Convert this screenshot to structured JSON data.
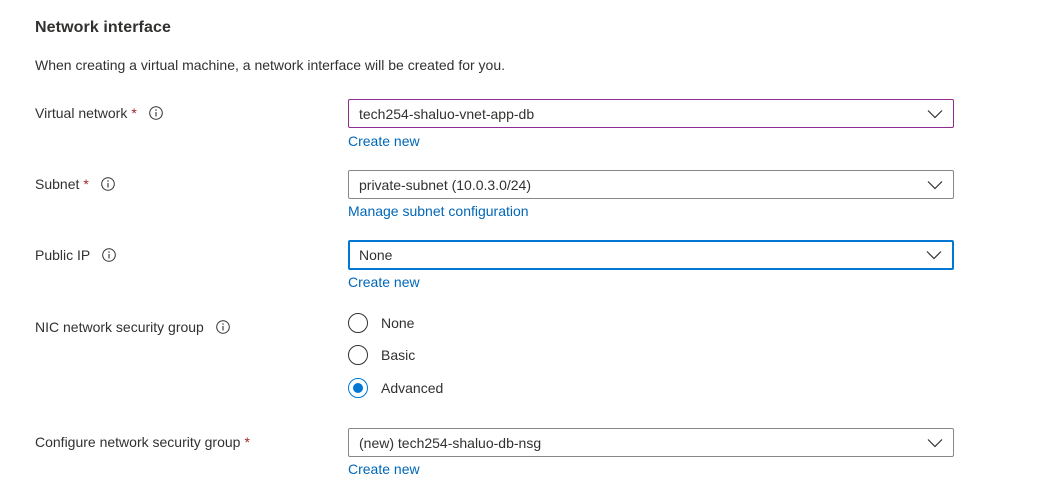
{
  "section": {
    "title": "Network interface",
    "description": "When creating a virtual machine, a network interface will be created for you."
  },
  "fields": {
    "virtual_network": {
      "label": "Virtual network",
      "required_mark": "*",
      "value": "tech254-shaluo-vnet-app-db",
      "link": "Create new"
    },
    "subnet": {
      "label": "Subnet",
      "required_mark": "*",
      "value": "private-subnet (10.0.3.0/24)",
      "link": "Manage subnet configuration"
    },
    "public_ip": {
      "label": "Public IP",
      "value": "None",
      "link": "Create new"
    },
    "nic_nsg": {
      "label": "NIC network security group",
      "options": [
        "None",
        "Basic",
        "Advanced"
      ],
      "selected": "Advanced"
    },
    "configure_nsg": {
      "label": "Configure network security group",
      "required_mark": "*",
      "value": "(new) tech254-shaluo-db-nsg",
      "link": "Create new"
    }
  },
  "colors": {
    "link": "#0067b8",
    "required": "#a4262c",
    "focus_border": "#0078d4",
    "accent_border": "#8d2b8f",
    "text": "#323130"
  },
  "icons": {
    "info": "info-icon",
    "dropdown": "chevron-down-icon"
  }
}
